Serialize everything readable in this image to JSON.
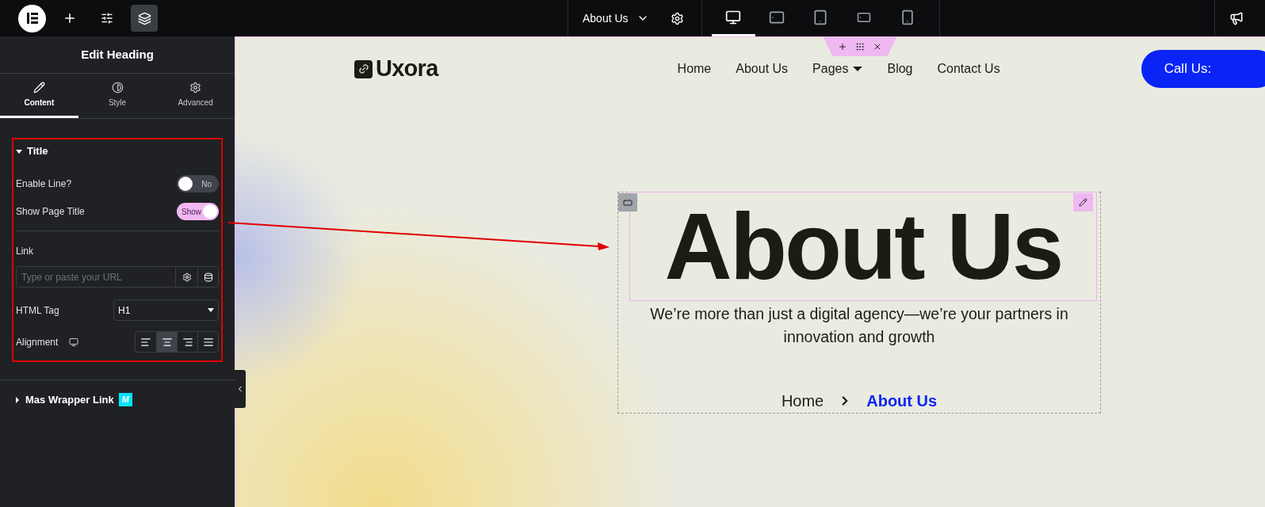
{
  "topbar": {
    "page_title": "About Us",
    "devices": [
      {
        "kind": "desktop",
        "selected": true
      },
      {
        "kind": "tablet-landscape",
        "selected": false
      },
      {
        "kind": "tablet",
        "selected": false
      },
      {
        "kind": "mobile-landscape",
        "selected": false
      },
      {
        "kind": "mobile",
        "selected": false
      }
    ]
  },
  "panel": {
    "title": "Edit Heading",
    "tabs": [
      {
        "label": "Content",
        "selected": true
      },
      {
        "label": "Style",
        "selected": false
      },
      {
        "label": "Advanced",
        "selected": false
      }
    ],
    "section": {
      "title": "Title",
      "expanded": true,
      "toggles": [
        {
          "label": "Enable Line?",
          "on": false,
          "text": "No"
        },
        {
          "label": "Show Page Title",
          "on": true,
          "text": "Show"
        }
      ],
      "link": {
        "label": "Link",
        "placeholder": "Type or paste your URL"
      },
      "html_tag": {
        "label": "HTML Tag",
        "value": "H1"
      },
      "alignment": {
        "label": "Alignment",
        "options": [
          {
            "kind": "left",
            "selected": false
          },
          {
            "kind": "center",
            "selected": true
          },
          {
            "kind": "right",
            "selected": false
          },
          {
            "kind": "justify",
            "selected": false
          }
        ]
      }
    },
    "collapsed_section": {
      "title": "Mas Wrapper Link",
      "expanded": false,
      "badge": "M"
    }
  },
  "site": {
    "logo": "Uxora",
    "nav": [
      {
        "label": "Home",
        "dropdown": false
      },
      {
        "label": "About Us",
        "dropdown": false
      },
      {
        "label": "Pages",
        "dropdown": true
      },
      {
        "label": "Blog",
        "dropdown": false
      },
      {
        "label": "Contact Us",
        "dropdown": false
      }
    ],
    "cta": "Call Us:",
    "hero": {
      "title": "About Us",
      "subtitle": "We’re more than just a digital agency—we’re your partners in innovation and growth",
      "breadcrumb": [
        {
          "label": "Home",
          "current": false
        },
        {
          "label": "About Us",
          "current": true
        }
      ]
    }
  }
}
